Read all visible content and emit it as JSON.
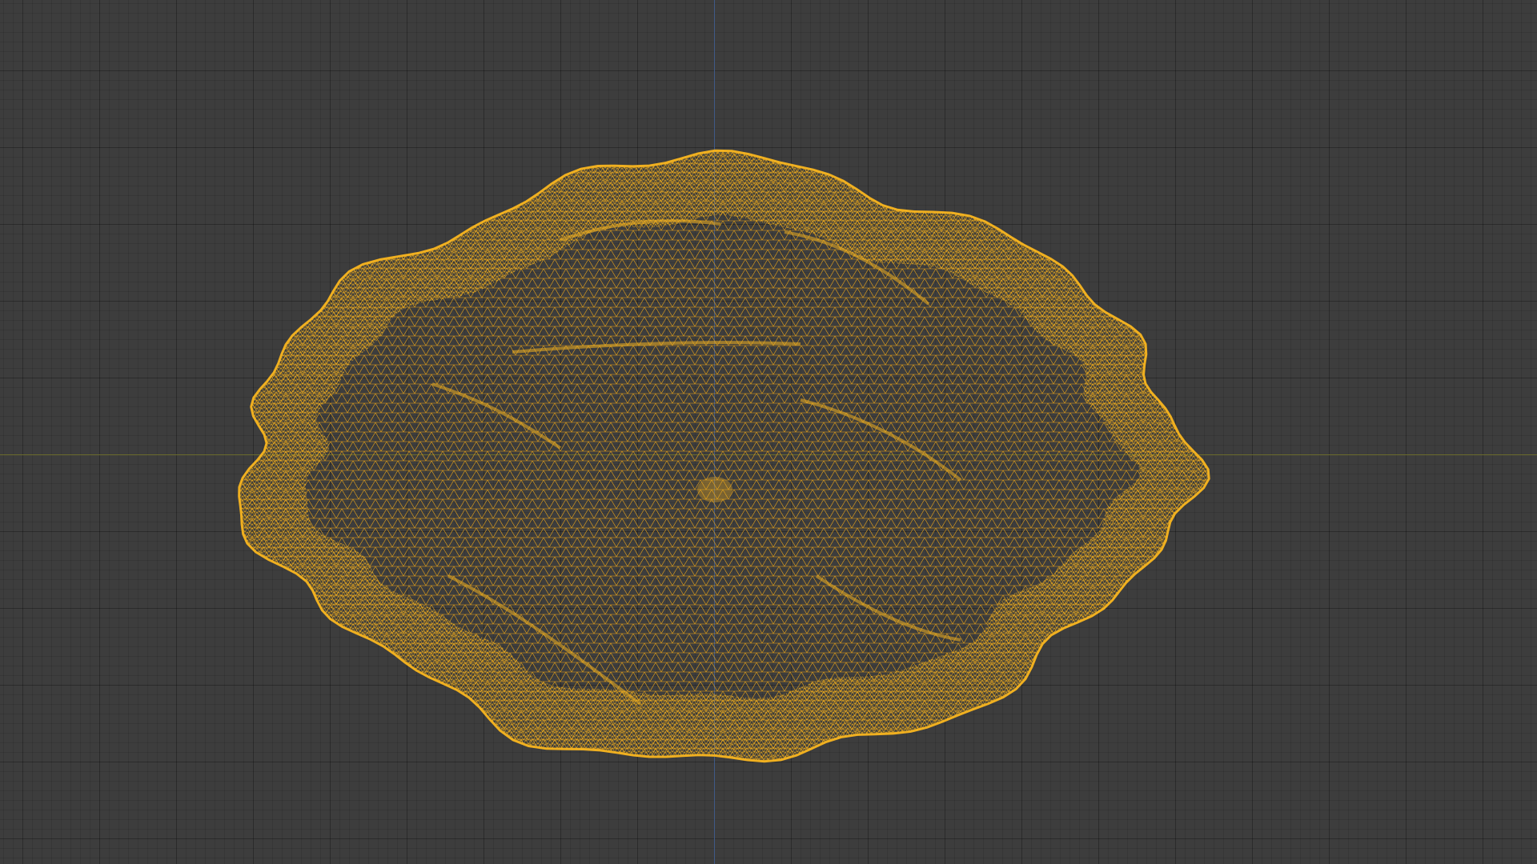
{
  "viewport": {
    "background": "#3d3d3d",
    "grid_color": "#2f2f2f",
    "axis_x_color": "#6b6b2c",
    "axis_y_color": "#3f5a88"
  },
  "mesh": {
    "object": "rock-mesh",
    "display": "wireframe",
    "selected": true,
    "wire_color": "#e8a318",
    "dense_wire_color": "#f0b020"
  }
}
